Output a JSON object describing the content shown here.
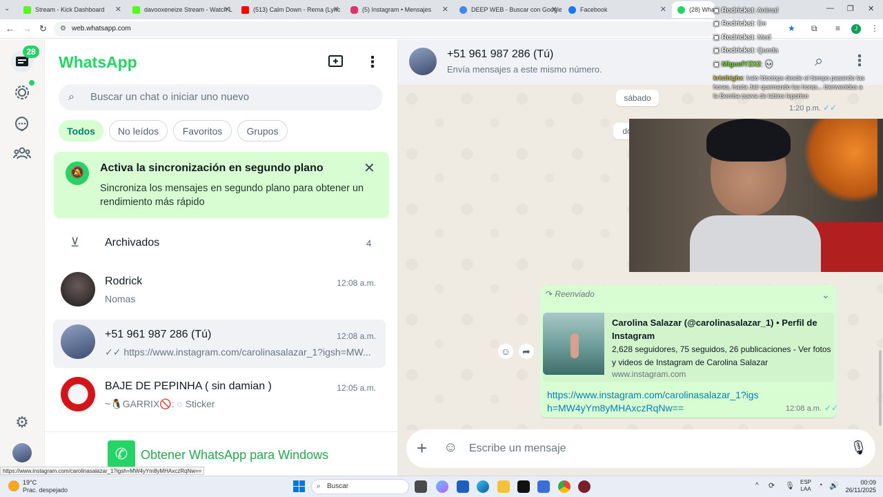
{
  "browser": {
    "tabs": [
      {
        "label": "Stream - Kick Dashboard",
        "color": "#53fc18"
      },
      {
        "label": "davooxeneize Stream - Watch L",
        "color": "#53fc18"
      },
      {
        "label": "(513) Calm Down - Rema (Lyric",
        "color": "#ff0000"
      },
      {
        "label": "(5) Instagram • Mensajes",
        "color": "#e1306c"
      },
      {
        "label": "DEEP WEB - Buscar con Google",
        "color": "#4285f4"
      },
      {
        "label": "Facebook",
        "color": "#1877f2"
      },
      {
        "label": "(28) WhatsApp",
        "color": "#25d366"
      }
    ],
    "url": "web.whatsapp.com",
    "status_url": "https://www.instagram.com/carolinasalazar_1?igsh=MW4yYm8yMHAxczRqNw=="
  },
  "rail": {
    "chats_badge": "28",
    "profile_initial": "J"
  },
  "sidebar": {
    "title": "WhatsApp",
    "search_placeholder": "Buscar un chat o iniciar uno nuevo",
    "filters": [
      "Todos",
      "No leídos",
      "Favoritos",
      "Grupos"
    ],
    "sync_title": "Activa la sincronización en segundo plano",
    "sync_body": "Sincroniza los mensajes en segundo plano para obtener un rendimiento más rápido",
    "archived_label": "Archivados",
    "archived_count": "4",
    "chats": [
      {
        "name": "Rodrick",
        "time": "12:08 a.m.",
        "preview": "Nomas"
      },
      {
        "name": "+51 961 987 286 (Tú)",
        "time": "12:08 a.m.",
        "preview": "✓✓ https://www.instagram.com/carolinasalazar_1?igsh=MW..."
      },
      {
        "name": "BAJE DE PEPINHA ( sin damian )",
        "time": "12:05 a.m.",
        "preview": "~🐧GARRIX🚫: ◌ Sticker"
      }
    ],
    "get_app": "Obtener WhatsApp para Windows"
  },
  "chat": {
    "contact_name": "+51 961 987 286 (Tú)",
    "contact_sub": "Envía mensajes a este mismo número.",
    "day_label": "sábado",
    "day_label_2": "do",
    "prev_time": "1:20 p.m.",
    "forwarded": "Reenviado",
    "preview_title": "Carolina Salazar (@carolinasalazar_1) • Perfil de Instagram",
    "preview_desc": "2,628 seguidores, 75 seguidos, 26 publicaciones - Ver fotos y videos de Instagram de Carolina Salazar",
    "preview_domain": "www.instagram.com",
    "link_text": "https://www.instagram.com/carolinasalazar_1?igsh=MW4yYm8yMHAxczRqNw==",
    "msg_time": "12:08 a.m.",
    "composer_placeholder": "Escribe un mensaje"
  },
  "stream_chat": [
    {
      "user": "Rodrickst",
      "text": ": Animal"
    },
    {
      "user": "Rodrickst",
      "text": ": De"
    },
    {
      "user": "Rodrickst",
      "text": ": Med"
    },
    {
      "user": "Rodrickst",
      "text": ": Queda"
    },
    {
      "user": "MiguelYZX2",
      "text": ": 💀"
    },
    {
      "user": "kristhighx",
      "text": ": Iralo fdoctops desde el tiempo pasando las horas, hasta Jair quemando las horas... bienvenidos a la Bemba cueva de labios leporino"
    }
  ],
  "taskbar": {
    "temp": "19°C",
    "weather": "Prac. despejado",
    "search": "Buscar",
    "lang": "ESP",
    "lang2": "LAA",
    "time": "00:09",
    "date": "26/11/2025"
  }
}
